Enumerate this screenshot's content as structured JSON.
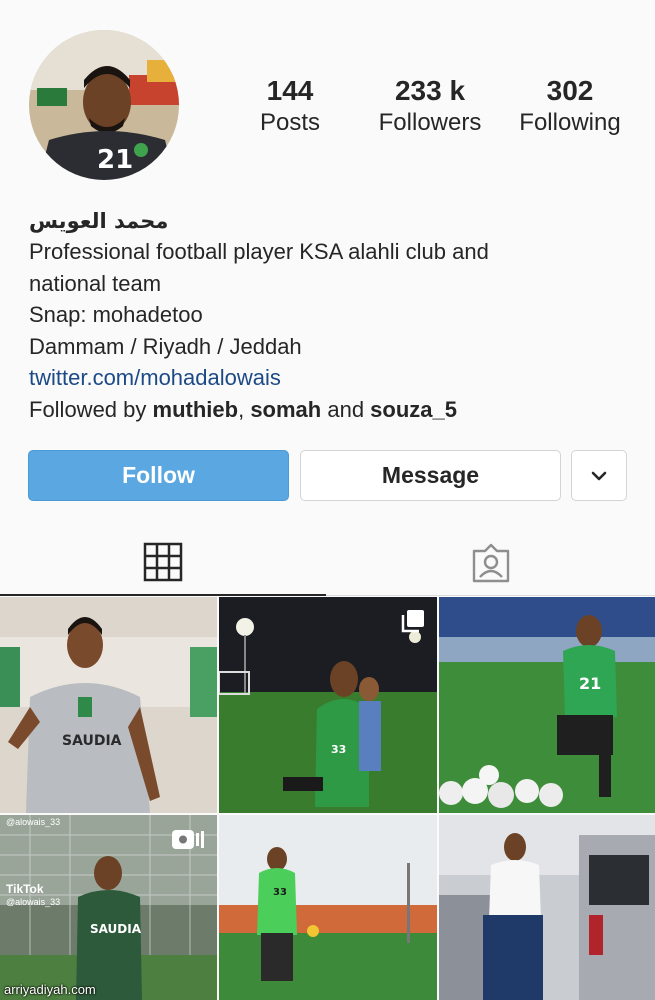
{
  "profile": {
    "name_ar": "محمد العويس",
    "bio_line1": "Professional football player KSA alahli club and",
    "bio_line2": "national team",
    "bio_line3": "Snap: mohadetoo",
    "bio_line4": "Dammam / Riyadh / Jeddah",
    "link": "twitter.com/mohadalowais",
    "followed_by_prefix": "Followed by ",
    "followed_user1": "muthieb",
    "followed_sep": ", ",
    "followed_user2": "somah",
    "followed_and": " and ",
    "followed_user3": "souza_5"
  },
  "stats": {
    "posts_count": "144",
    "posts_label": "Posts",
    "followers_count": "233 k",
    "followers_label": "Followers",
    "following_count": "302",
    "following_label": "Following"
  },
  "actions": {
    "follow_label": "Follow",
    "message_label": "Message",
    "more_icon": "chevron-down-icon"
  },
  "tabs": {
    "grid_icon": "grid-icon",
    "tagged_icon": "tagged-person-icon"
  },
  "posts": [
    {
      "badge": ""
    },
    {
      "badge": "multiple-photos-icon"
    },
    {
      "badge": ""
    },
    {
      "badge": "igtv-icon"
    },
    {
      "badge": ""
    },
    {
      "badge": ""
    }
  ],
  "overlay": {
    "cell4_tag1": "@alowais_33",
    "cell4_tiktok": "TikTok",
    "cell4_tag2": "@alowais_33",
    "cell1_shirt": "SAUDIA",
    "cell4_shirt": "SAUDIA",
    "shirt_num_21": "21",
    "shirt_num_33": "33"
  },
  "watermark": "arriyadiyah.com",
  "colors": {
    "follow_bg": "#5aa7e1",
    "link": "#1c4a86",
    "text": "#262626"
  }
}
